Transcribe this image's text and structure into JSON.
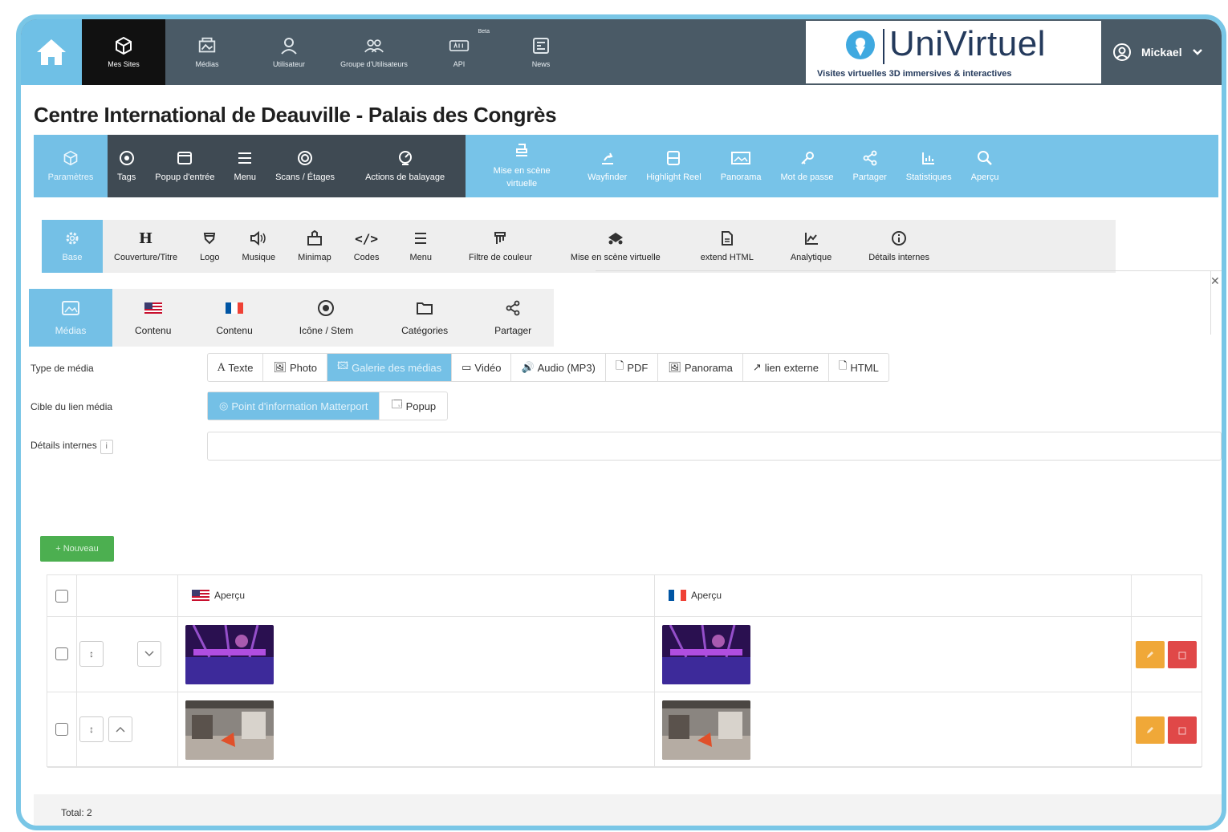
{
  "topnav": {
    "items": [
      {
        "label": "Mes Sites",
        "icon": "cube-icon"
      },
      {
        "label": "Médias",
        "icon": "media-icon"
      },
      {
        "label": "Utilisateur",
        "icon": "user-icon"
      },
      {
        "label": "Groupe d'Utilisateurs",
        "icon": "users-icon"
      },
      {
        "label": "API",
        "icon": "api-icon",
        "badge": "Beta"
      },
      {
        "label": "News",
        "icon": "news-icon"
      }
    ],
    "brand_name": "UniVirtuel",
    "brand_tagline": "Visites virtuelles 3D immersives & interactives",
    "user_name": "Mickael"
  },
  "page_title": "Centre International de Deauville - Palais des Congrès",
  "toolbar_main": {
    "items": [
      {
        "label": "Paramètres",
        "icon": "cube-icon"
      },
      {
        "label": "Tags",
        "icon": "target-icon"
      },
      {
        "label": "Popup d'entrée",
        "icon": "window-icon"
      },
      {
        "label": "Menu",
        "icon": "menu-icon"
      },
      {
        "label": "Scans / Étages",
        "icon": "scan-icon"
      },
      {
        "label": "Actions de balayage",
        "icon": "sweep-icon"
      },
      {
        "label": "Mise en scène virtuelle",
        "icon": "stage-icon"
      },
      {
        "label": "Wayfinder",
        "icon": "wayfinder-icon"
      },
      {
        "label": "Highlight Reel",
        "icon": "reel-icon"
      },
      {
        "label": "Panorama",
        "icon": "panorama-icon"
      },
      {
        "label": "Mot de passe",
        "icon": "key-icon"
      },
      {
        "label": "Partager",
        "icon": "share-icon"
      },
      {
        "label": "Statistiques",
        "icon": "chart-icon"
      },
      {
        "label": "Aperçu",
        "icon": "search-icon"
      }
    ]
  },
  "toolbar_sub": {
    "items": [
      {
        "label": "Base",
        "icon": "gear-icon"
      },
      {
        "label": "Couverture/Titre",
        "icon": "heading-icon"
      },
      {
        "label": "Logo",
        "icon": "shield-icon"
      },
      {
        "label": "Musique",
        "icon": "speaker-icon"
      },
      {
        "label": "Minimap",
        "icon": "minimap-icon"
      },
      {
        "label": "Codes",
        "icon": "code-icon"
      },
      {
        "label": "Menu",
        "icon": "menu-icon"
      },
      {
        "label": "Filtre de couleur",
        "icon": "filter-icon"
      },
      {
        "label": "Mise en scène virtuelle",
        "icon": "stage-icon"
      },
      {
        "label": "extend HTML",
        "icon": "file-icon"
      },
      {
        "label": "Analytique",
        "icon": "analytics-icon"
      },
      {
        "label": "Détails internes",
        "icon": "info-icon"
      }
    ]
  },
  "tabs": [
    {
      "label": "Médias",
      "icon": "image-icon"
    },
    {
      "label": "Contenu",
      "icon": "flag-us-icon"
    },
    {
      "label": "Contenu",
      "icon": "flag-fr-icon"
    },
    {
      "label": "Icône / Stem",
      "icon": "target-icon"
    },
    {
      "label": "Catégories",
      "icon": "folder-icon"
    },
    {
      "label": "Partager",
      "icon": "share-icon"
    }
  ],
  "form": {
    "media_type_label": "Type de média",
    "media_types": [
      "Texte",
      "Photo",
      "Galerie des médias",
      "Vidéo",
      "Audio (MP3)",
      "PDF",
      "Panorama",
      "lien externe",
      "HTML"
    ],
    "media_type_selected": "Galerie des médias",
    "link_target_label": "Cible du lien média",
    "link_targets": [
      "Point d'information Matterport",
      "Popup"
    ],
    "link_target_selected": "Point d'information Matterport",
    "details_label": "Détails internes",
    "details_badge": "i",
    "details_value": ""
  },
  "new_button": "+ Nouveau",
  "table": {
    "columns": [
      "Aperçu",
      "Aperçu"
    ],
    "rows": [
      {
        "image": "concert-stage-image"
      },
      {
        "image": "exhibition-hall-image"
      }
    ]
  },
  "footer": {
    "total": "Total: 2"
  },
  "colors": {
    "accent": "#74c0e6",
    "nav_dark": "#4a5a66",
    "new_green": "#4caf50",
    "edit_orange": "#f0a838",
    "delete_red": "#e04848"
  }
}
